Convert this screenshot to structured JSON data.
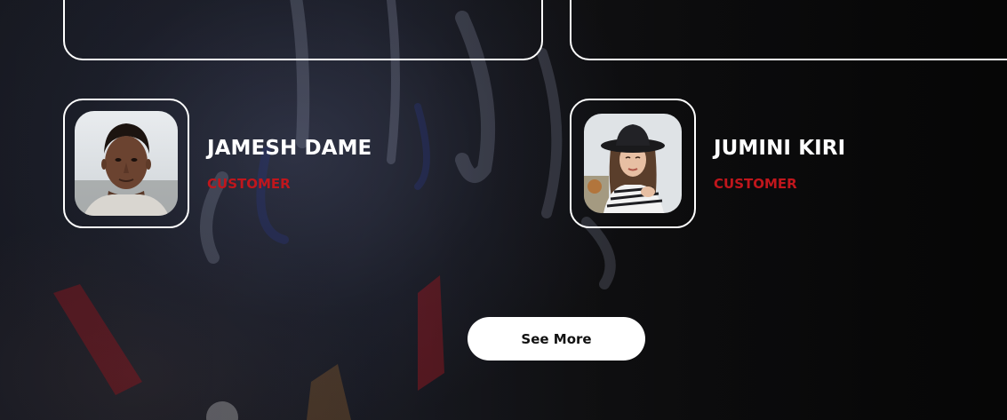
{
  "testimonials": [
    {
      "name": "JAMESH DAME",
      "role": "CUSTOMER",
      "avatar_icon": "man-portrait"
    },
    {
      "name": "JUMINI KIRI",
      "role": "CUSTOMER",
      "avatar_icon": "woman-hat-portrait"
    }
  ],
  "actions": {
    "see_more_label": "See More"
  },
  "colors": {
    "accent": "#c0161c",
    "card_border": "#ffffff",
    "button_bg": "#ffffff"
  }
}
